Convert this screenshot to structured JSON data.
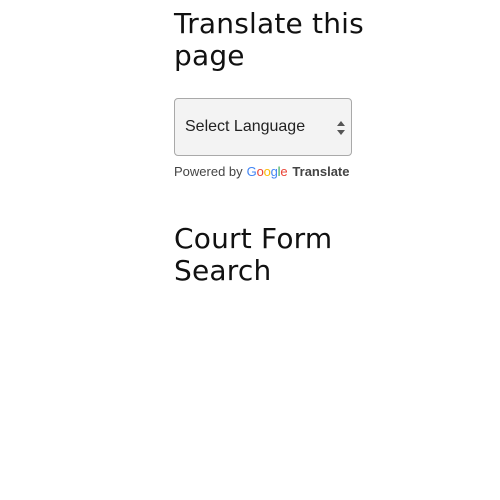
{
  "translate_section": {
    "title": "Translate this page",
    "select": {
      "selected_value": "Select Language"
    },
    "powered_by": {
      "prefix": "Powered by",
      "logo_letters": [
        "G",
        "o",
        "o",
        "g",
        "l",
        "e"
      ],
      "link_label": "Translate"
    }
  },
  "court_form_section": {
    "title": "Court Form Search"
  },
  "colors": {
    "google_blue": "#4285F4",
    "google_red": "#EA4335",
    "google_yellow": "#FBBC05",
    "google_green": "#34A853"
  },
  "icons": {
    "select_arrows": "up-down-arrows-icon"
  }
}
